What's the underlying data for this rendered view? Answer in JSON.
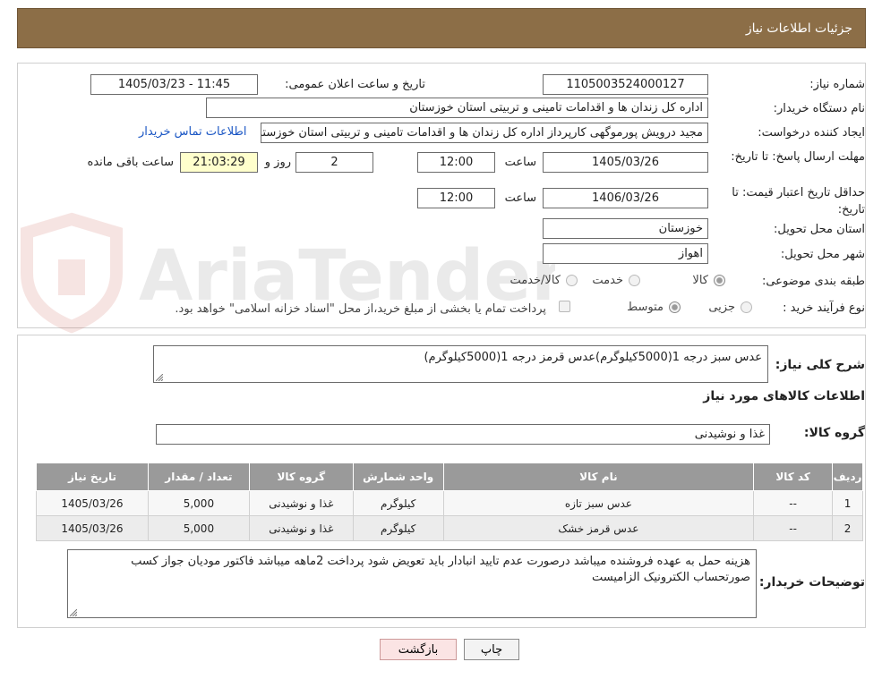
{
  "header": {
    "title": "جزئیات اطلاعات نیاز"
  },
  "form": {
    "need_number": {
      "label": "شماره نیاز:",
      "value": "1105003524000127"
    },
    "announce": {
      "label": "تاریخ و ساعت اعلان عمومی:",
      "value": "1405/03/23 - 11:45"
    },
    "buyer_org": {
      "label": "نام دستگاه خریدار:",
      "value": "اداره کل زندان ها و اقدامات تامینی و تربیتی استان خوزستان"
    },
    "requester": {
      "label": "ایجاد کننده درخواست:",
      "value": "مجید درویش پورموگهی کارپرداز اداره کل زندان ها و اقدامات تامینی و تربیتی استان خوزستان",
      "contact_link": "اطلاعات تماس خریدار"
    },
    "deadline": {
      "label": "مهلت ارسال پاسخ: تا تاریخ:",
      "date": "1405/03/26",
      "time_label": "ساعت",
      "time": "12:00",
      "days": "2",
      "days_label": "روز و",
      "remaining": "21:03:29",
      "remaining_label": "ساعت باقی مانده"
    },
    "validity": {
      "label": "حداقل تاریخ اعتبار قیمت: تا تاریخ:",
      "date": "1406/03/26",
      "time_label": "ساعت",
      "time": "12:00"
    },
    "province": {
      "label": "استان محل تحویل:",
      "value": "خوزستان"
    },
    "city": {
      "label": "شهر محل تحویل:",
      "value": "اهواز"
    },
    "category": {
      "label": "طبقه بندی موضوعی:",
      "options": [
        "کالا",
        "خدمت",
        "کالا/خدمت"
      ]
    },
    "process": {
      "label": "نوع فرآیند خرید :",
      "options": [
        "جزیی",
        "متوسط"
      ],
      "payment_note": "پرداخت تمام یا بخشی از مبلغ خرید،از محل \"اسناد خزانه اسلامی\" خواهد بود."
    }
  },
  "summary": {
    "label": "شرح کلی نیاز:",
    "value": "عدس سبز درجه 1(5000کیلوگرم)عدس قرمز درجه 1(5000کیلوگرم)"
  },
  "goods_section": {
    "title": "اطلاعات کالاهای مورد نیاز",
    "group_label": "گروه کالا:",
    "group_value": "غذا و نوشیدنی"
  },
  "table": {
    "headers": [
      "ردیف",
      "کد کالا",
      "نام کالا",
      "واحد شمارش",
      "گروه کالا",
      "تعداد / مقدار",
      "تاریخ نیاز"
    ],
    "rows": [
      [
        "1",
        "--",
        "عدس سبز تازه",
        "کیلوگرم",
        "غذا و نوشیدنی",
        "5,000",
        "1405/03/26"
      ],
      [
        "2",
        "--",
        "عدس قرمز خشک",
        "کیلوگرم",
        "غذا و نوشیدنی",
        "5,000",
        "1405/03/26"
      ]
    ]
  },
  "notes": {
    "label": "توضیحات خریدار:",
    "value": "هزینه حمل به عهده فروشنده میباشد درصورت عدم تایید انبادار باید تعویض شود پرداخت 2ماهه میباشد فاکتور مودیان جواز کسب صورتحساب الکترونیک الزامیست"
  },
  "buttons": {
    "back": "بازگشت",
    "print": "چاپ"
  },
  "watermark": {
    "text": "AriaTender.neT"
  },
  "colors": {
    "header": "#8c6e47",
    "table_header": "#9a9a9a",
    "link": "#1a56c4",
    "remaining_bg": "#ffffcc"
  },
  "icons": {
    "watermark_logo": "shield-logo-icon",
    "resize_handle": "resize-grip-icon"
  }
}
